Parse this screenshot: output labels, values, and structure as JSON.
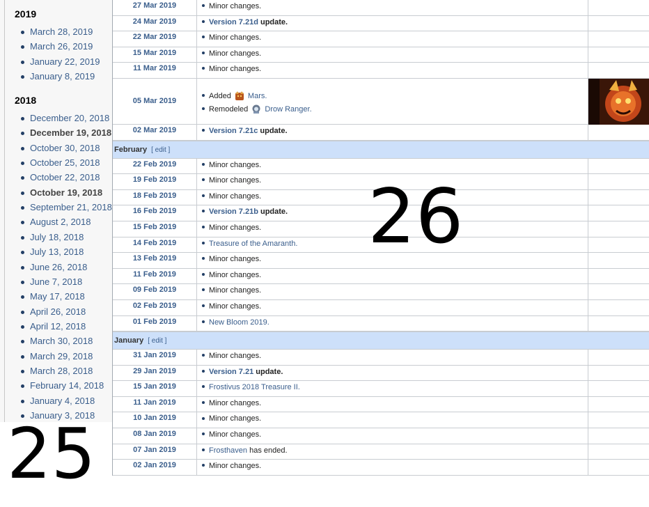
{
  "sidebar": {
    "groups": [
      {
        "year": "2019",
        "items": [
          {
            "label": "March 28, 2019",
            "bold": false
          },
          {
            "label": "March 26, 2019",
            "bold": false
          },
          {
            "label": "January 22, 2019",
            "bold": false
          },
          {
            "label": "January 8, 2019",
            "bold": false
          }
        ]
      },
      {
        "year": "2018",
        "items": [
          {
            "label": "December 20, 2018",
            "bold": false
          },
          {
            "label": "December 19, 2018",
            "bold": true
          },
          {
            "label": "October 30, 2018",
            "bold": false
          },
          {
            "label": "October 25, 2018",
            "bold": false
          },
          {
            "label": "October 22, 2018",
            "bold": false
          },
          {
            "label": "October 19, 2018",
            "bold": true
          },
          {
            "label": "September 21, 2018",
            "bold": false
          },
          {
            "label": "August 2, 2018",
            "bold": false
          },
          {
            "label": "July 18, 2018",
            "bold": false
          },
          {
            "label": "July 13, 2018",
            "bold": false
          },
          {
            "label": "June 26, 2018",
            "bold": false
          },
          {
            "label": "June 7, 2018",
            "bold": false
          },
          {
            "label": "May 17, 2018",
            "bold": false
          },
          {
            "label": "April 26, 2018",
            "bold": false
          },
          {
            "label": "April 12, 2018",
            "bold": false
          },
          {
            "label": "March 30, 2018",
            "bold": false
          },
          {
            "label": "March 29, 2018",
            "bold": false
          },
          {
            "label": "March 28, 2018",
            "bold": false
          },
          {
            "label": "February 14, 2018",
            "bold": false
          },
          {
            "label": "January 4, 2018",
            "bold": false
          },
          {
            "label": "January 3, 2018",
            "bold": false
          }
        ]
      }
    ]
  },
  "overlay_numbers": {
    "left": "25",
    "right": "26"
  },
  "table": {
    "edit_label": "[ edit ]",
    "rows": [
      {
        "type": "row",
        "date": "27 Mar 2019",
        "lines": [
          [
            {
              "t": "Minor changes."
            }
          ]
        ]
      },
      {
        "type": "row",
        "date": "24 Mar 2019",
        "lines": [
          [
            {
              "t": "Version 7.21d",
              "s": "lnkb"
            },
            {
              "t": " update.",
              "s": "b"
            }
          ]
        ]
      },
      {
        "type": "row",
        "date": "22 Mar 2019",
        "lines": [
          [
            {
              "t": "Minor changes."
            }
          ]
        ]
      },
      {
        "type": "row",
        "date": "15 Mar 2019",
        "lines": [
          [
            {
              "t": "Minor changes."
            }
          ]
        ]
      },
      {
        "type": "row",
        "date": "11 Mar 2019",
        "lines": [
          [
            {
              "t": "Minor changes."
            }
          ]
        ]
      },
      {
        "type": "row",
        "date": "05 Mar 2019",
        "tall": true,
        "lines": [
          [
            {
              "t": "Added "
            },
            {
              "icon": "mars-icon"
            },
            {
              "t": " Mars.",
              "s": "lnk"
            }
          ],
          [
            {
              "t": "Remodeled "
            },
            {
              "icon": "drow-ranger-icon"
            },
            {
              "t": " Drow Ranger.",
              "s": "lnk"
            }
          ]
        ]
      },
      {
        "type": "row",
        "date": "02 Mar 2019",
        "lines": [
          [
            {
              "t": "Version 7.21c",
              "s": "lnkb"
            },
            {
              "t": " update.",
              "s": "b"
            }
          ]
        ]
      },
      {
        "type": "month",
        "label": "February"
      },
      {
        "type": "row",
        "date": "22 Feb 2019",
        "lines": [
          [
            {
              "t": "Minor changes."
            }
          ]
        ]
      },
      {
        "type": "row",
        "date": "19 Feb 2019",
        "lines": [
          [
            {
              "t": "Minor changes."
            }
          ]
        ]
      },
      {
        "type": "row",
        "date": "18 Feb 2019",
        "lines": [
          [
            {
              "t": "Minor changes."
            }
          ]
        ]
      },
      {
        "type": "row",
        "date": "16 Feb 2019",
        "lines": [
          [
            {
              "t": "Version 7.21b",
              "s": "lnkb"
            },
            {
              "t": " update.",
              "s": "b"
            }
          ]
        ]
      },
      {
        "type": "row",
        "date": "15 Feb 2019",
        "lines": [
          [
            {
              "t": "Minor changes."
            }
          ]
        ]
      },
      {
        "type": "row",
        "date": "14 Feb 2019",
        "lines": [
          [
            {
              "t": "Treasure of the Amaranth.",
              "s": "lnk"
            }
          ]
        ]
      },
      {
        "type": "row",
        "date": "13 Feb 2019",
        "lines": [
          [
            {
              "t": "Minor changes."
            }
          ]
        ]
      },
      {
        "type": "row",
        "date": "11 Feb 2019",
        "lines": [
          [
            {
              "t": "Minor changes."
            }
          ]
        ]
      },
      {
        "type": "row",
        "date": "09 Feb 2019",
        "lines": [
          [
            {
              "t": "Minor changes."
            }
          ]
        ]
      },
      {
        "type": "row",
        "date": "02 Feb 2019",
        "lines": [
          [
            {
              "t": "Minor changes."
            }
          ]
        ]
      },
      {
        "type": "row",
        "date": "01 Feb 2019",
        "lines": [
          [
            {
              "t": "New Bloom 2019.",
              "s": "lnk"
            }
          ]
        ]
      },
      {
        "type": "month",
        "label": "January"
      },
      {
        "type": "row",
        "date": "31 Jan 2019",
        "lines": [
          [
            {
              "t": "Minor changes."
            }
          ]
        ]
      },
      {
        "type": "row",
        "date": "29 Jan 2019",
        "lines": [
          [
            {
              "t": "Version 7.21",
              "s": "lnkb"
            },
            {
              "t": " update.",
              "s": "b"
            }
          ]
        ]
      },
      {
        "type": "row",
        "date": "15 Jan 2019",
        "lines": [
          [
            {
              "t": "Frostivus 2018 Treasure II.",
              "s": "lnk"
            }
          ]
        ]
      },
      {
        "type": "row",
        "date": "11 Jan 2019",
        "lines": [
          [
            {
              "t": "Minor changes."
            }
          ]
        ]
      },
      {
        "type": "row",
        "date": "10 Jan 2019",
        "lines": [
          [
            {
              "t": "Minor changes."
            }
          ]
        ]
      },
      {
        "type": "row",
        "date": "08 Jan 2019",
        "lines": [
          [
            {
              "t": "Minor changes."
            }
          ]
        ]
      },
      {
        "type": "row",
        "date": "07 Jan 2019",
        "lines": [
          [
            {
              "t": "Frosthaven",
              "s": "lnk"
            },
            {
              "t": " has ended."
            }
          ]
        ]
      },
      {
        "type": "row",
        "date": "02 Jan 2019",
        "lines": [
          [
            {
              "t": "Minor changes."
            }
          ]
        ]
      }
    ]
  },
  "colors": {
    "link": "#3a5e8c",
    "month_header_bg": "#cde0fa",
    "sidebar_bg": "#f7f7f7"
  }
}
